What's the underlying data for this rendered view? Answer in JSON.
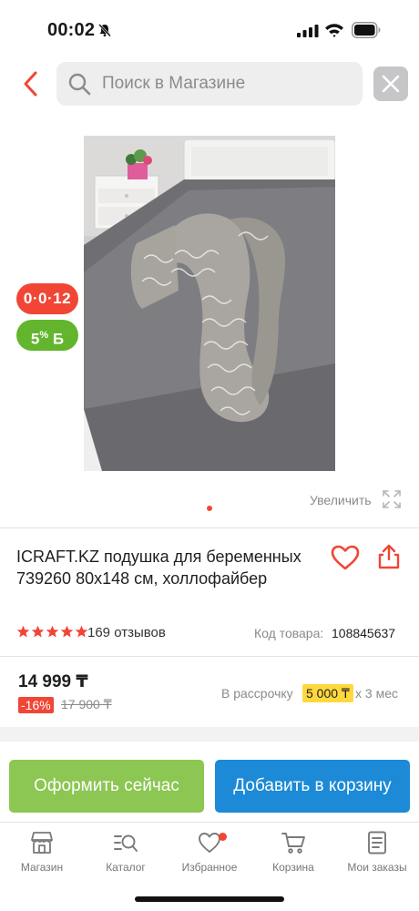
{
  "status_bar": {
    "time": "00:02"
  },
  "header": {
    "search_placeholder": "Поиск в Магазине"
  },
  "gallery": {
    "installment_badge": "0·0·12",
    "bonus_badge_value": "5",
    "bonus_badge_suffix": "Б",
    "zoom_label": "Увеличить",
    "slide_count": 1,
    "active_slide": 1
  },
  "product": {
    "title": "ICRAFT.KZ подушка для беременных 739260 80x148 см, холлофайбер",
    "rating_stars": 5,
    "reviews": "169 отзывов",
    "code_label": "Код товара:",
    "code_value": "108845637"
  },
  "price": {
    "current": "14 999 ₸",
    "discount": "-16%",
    "old": "17 900 ₸",
    "installment_label": "В рассрочку",
    "installment_amount": "5 000 ₸",
    "installment_term": "x 3 мес"
  },
  "actions": {
    "checkout_label": "Оформить сейчас",
    "cart_label": "Добавить в корзину"
  },
  "bottom_nav": {
    "items": [
      {
        "label": "Магазин",
        "icon": "shop-icon"
      },
      {
        "label": "Каталог",
        "icon": "catalog-icon"
      },
      {
        "label": "Избранное",
        "icon": "favorites-icon",
        "has_badge": true
      },
      {
        "label": "Корзина",
        "icon": "cart-icon"
      },
      {
        "label": "Мои заказы",
        "icon": "orders-icon"
      }
    ]
  },
  "colors": {
    "accent_red": "#f14635",
    "checkout_green": "#8cc653",
    "cart_blue": "#1c8ad6",
    "installment_yellow": "#ffd83d"
  }
}
